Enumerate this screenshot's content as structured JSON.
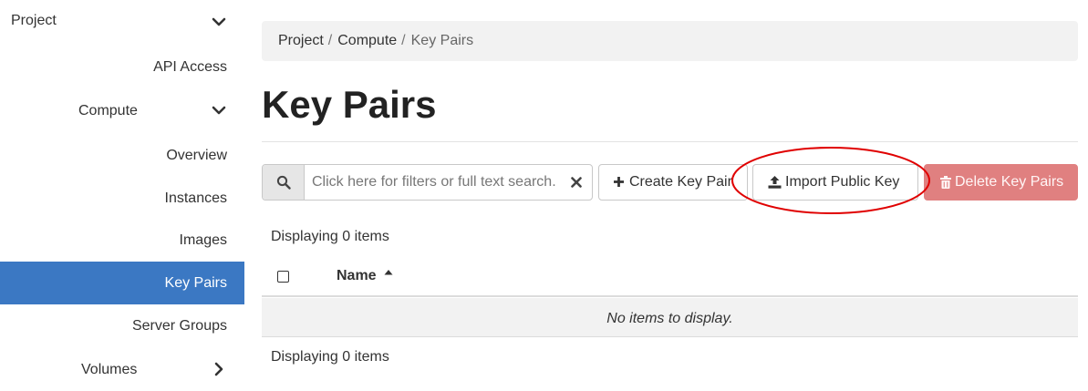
{
  "sidebar": {
    "project": "Project",
    "items": [
      {
        "label": "API Access"
      },
      {
        "label": "Compute"
      },
      {
        "label": "Overview"
      },
      {
        "label": "Instances"
      },
      {
        "label": "Images"
      },
      {
        "label": "Key Pairs",
        "active": true
      },
      {
        "label": "Server Groups"
      },
      {
        "label": "Volumes"
      }
    ]
  },
  "breadcrumb": {
    "items": [
      "Project",
      "Compute",
      "Key Pairs"
    ],
    "separator": "/"
  },
  "page": {
    "title": "Key Pairs"
  },
  "search": {
    "placeholder": "Click here for filters or full text search.",
    "value": ""
  },
  "toolbar": {
    "create_label": "Create Key Pair",
    "import_label": "Import Public Key",
    "delete_label": "Delete Key Pairs"
  },
  "table": {
    "count_top": "Displaying 0 items",
    "count_bottom": "Displaying 0 items",
    "columns": [
      "Name"
    ],
    "empty_message": "No items to display."
  },
  "icons": {
    "search": "search-icon",
    "clear": "times-icon",
    "create": "plus-icon",
    "import": "upload-icon",
    "delete": "trash-icon",
    "sort": "caret-up-icon",
    "expanded": "chevron-down-icon",
    "collapsed": "chevron-right-icon"
  },
  "colors": {
    "active_nav": "#3b78c3",
    "delete_button": "#e08080",
    "annotation": "#e00000"
  }
}
